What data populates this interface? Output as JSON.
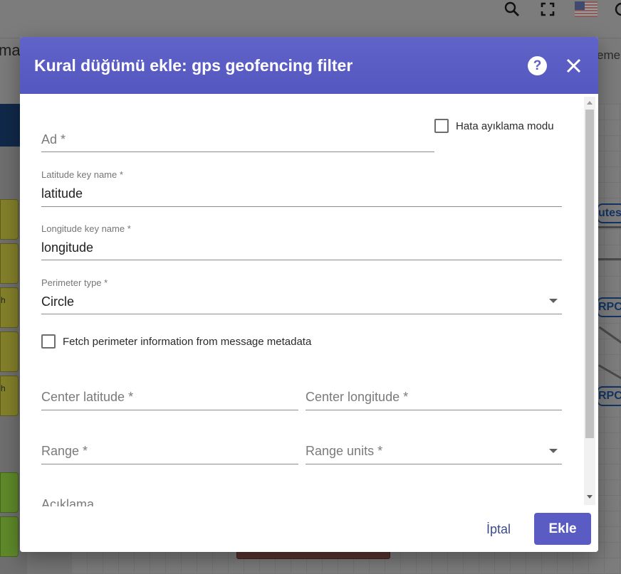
{
  "background": {
    "main_fragment": "mai",
    "right_fragment": "eme",
    "right_nodes": [
      "utes",
      "RPC",
      "RPC"
    ],
    "left_node_labels": [
      "h",
      "h"
    ]
  },
  "dialog": {
    "title": "Kural düğümü ekle: gps geofencing filter",
    "help_label": "?",
    "debug_mode_label": "Hata ayıklama modu",
    "name_placeholder": "Ad *",
    "latitude": {
      "label": "Latitude key name *",
      "value": "latitude"
    },
    "longitude": {
      "label": "Longitude key name *",
      "value": "longitude"
    },
    "perimeter_type": {
      "label": "Perimeter type *",
      "value": "Circle"
    },
    "fetch_metadata_label": "Fetch perimeter information from message metadata",
    "center_latitude_placeholder": "Center latitude *",
    "center_longitude_placeholder": "Center longitude *",
    "range_placeholder": "Range *",
    "range_units_placeholder": "Range units *",
    "description_placeholder": "Açıklama",
    "cancel_label": "İptal",
    "add_label": "Ekle"
  },
  "colors": {
    "header": "#5b5ec4",
    "primary_button": "#5a5cc3",
    "cancel_text": "#3b4a8a"
  }
}
